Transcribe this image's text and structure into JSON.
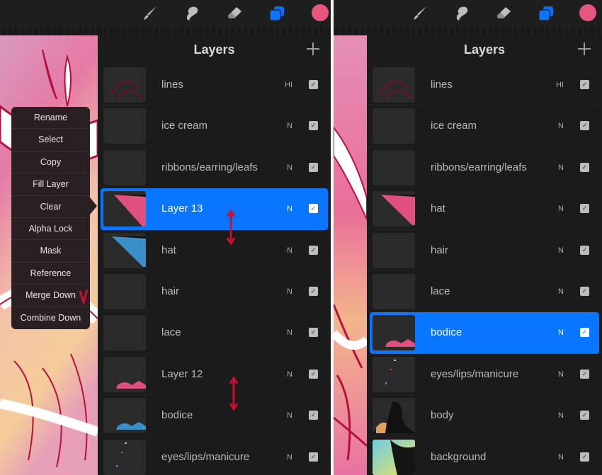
{
  "colors": {
    "accent": "#0a75ff",
    "current_color": "#e6577f",
    "annotation": "#c8102e"
  },
  "toolbar": {
    "tools": [
      {
        "name": "brush",
        "icon": "brush-icon"
      },
      {
        "name": "smudge",
        "icon": "smudge-icon"
      },
      {
        "name": "eraser",
        "icon": "eraser-icon"
      },
      {
        "name": "layers",
        "icon": "layers-icon",
        "active": true
      },
      {
        "name": "color",
        "icon": "color-swatch"
      }
    ]
  },
  "left": {
    "panel": {
      "title": "Layers",
      "add_icon": "plus-icon"
    },
    "layers": [
      {
        "name": "lines",
        "blend": "HI",
        "visible": true
      },
      {
        "name": "ice cream",
        "blend": "N",
        "visible": true
      },
      {
        "name": "ribbons/earring/leafs",
        "blend": "N",
        "visible": true
      },
      {
        "name": "Layer 13",
        "blend": "N",
        "visible": true,
        "selected": true
      },
      {
        "name": "hat",
        "blend": "N",
        "visible": true
      },
      {
        "name": "hair",
        "blend": "N",
        "visible": true
      },
      {
        "name": "lace",
        "blend": "N",
        "visible": true
      },
      {
        "name": "Layer 12",
        "blend": "N",
        "visible": true
      },
      {
        "name": "bodice",
        "blend": "N",
        "visible": true
      },
      {
        "name": "eyes/lips/manicure",
        "blend": "N",
        "visible": true
      }
    ],
    "context_menu": {
      "items": [
        "Rename",
        "Select",
        "Copy",
        "Fill Layer",
        "Clear",
        "Alpha Lock",
        "Mask",
        "Reference",
        "Merge Down",
        "Combine Down"
      ],
      "annotated_item": "Merge Down",
      "annotation_mark": "V"
    }
  },
  "right": {
    "panel": {
      "title": "Layers",
      "add_icon": "plus-icon"
    },
    "layers": [
      {
        "name": "lines",
        "blend": "HI",
        "visible": true
      },
      {
        "name": "ice cream",
        "blend": "N",
        "visible": true
      },
      {
        "name": "ribbons/earring/leafs",
        "blend": "N",
        "visible": true
      },
      {
        "name": "hat",
        "blend": "N",
        "visible": true
      },
      {
        "name": "hair",
        "blend": "N",
        "visible": true
      },
      {
        "name": "lace",
        "blend": "N",
        "visible": true
      },
      {
        "name": "bodice",
        "blend": "N",
        "visible": true,
        "selected": true
      },
      {
        "name": "eyes/lips/manicure",
        "blend": "N",
        "visible": true
      },
      {
        "name": "body",
        "blend": "N",
        "visible": true
      },
      {
        "name": "background",
        "blend": "N",
        "visible": true
      }
    ]
  },
  "check_glyph": "✓"
}
